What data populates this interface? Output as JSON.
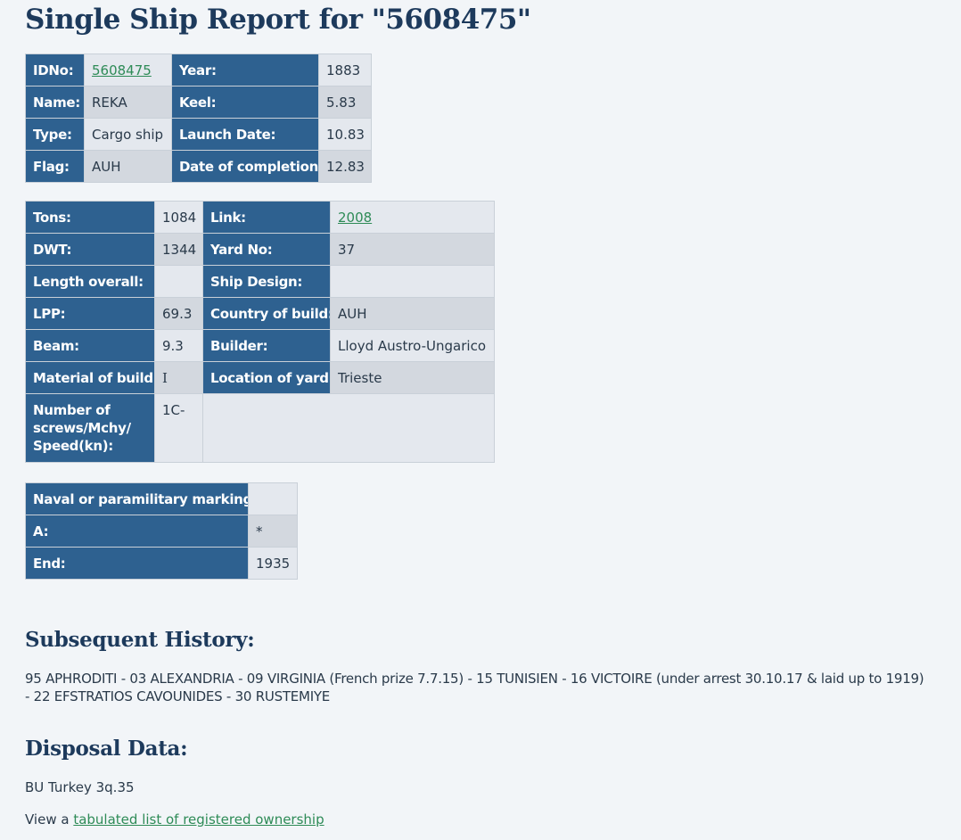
{
  "page_title": "Single Ship Report for \"5608475\"",
  "table1": {
    "rows": [
      {
        "l1": "IDNo:",
        "v1": "5608475",
        "l2": "Year:",
        "v2": "1883"
      },
      {
        "l1": "Name:",
        "v1": "REKA",
        "l2": "Keel:",
        "v2": "5.83"
      },
      {
        "l1": "Type:",
        "v1": "Cargo ship",
        "l2": "Launch Date:",
        "v2": "10.83"
      },
      {
        "l1": "Flag:",
        "v1": "AUH",
        "l2": "Date of completion:",
        "v2": "12.83"
      }
    ]
  },
  "table2": {
    "rows": [
      {
        "l1": "Tons:",
        "v1": "1084",
        "l2": "Link:",
        "v2": "2008"
      },
      {
        "l1": "DWT:",
        "v1": "1344",
        "l2": "Yard No:",
        "v2": "37"
      },
      {
        "l1": "Length overall:",
        "v1": "",
        "l2": "Ship Design:",
        "v2": ""
      },
      {
        "l1": "LPP:",
        "v1": "69.3",
        "l2": "Country of build:",
        "v2": "AUH"
      },
      {
        "l1": "Beam:",
        "v1": "9.3",
        "l2": "Builder:",
        "v2": "Lloyd Austro-Ungarico"
      },
      {
        "l1": "Material of build:",
        "v1": "I",
        "l2": "Location of yard:",
        "v2": "Trieste"
      },
      {
        "l1": "Number of screws/Mchy/ Speed(kn):",
        "v1": "1C-"
      }
    ]
  },
  "table3": {
    "rows": [
      {
        "l": "Naval or paramilitary marking :",
        "v": ""
      },
      {
        "l": "A:",
        "v": "*"
      },
      {
        "l": "End:",
        "v": "1935"
      }
    ]
  },
  "history": {
    "heading": "Subsequent History:",
    "text": "95 APHRODITI - 03 ALEXANDRIA - 09 VIRGINIA (French prize 7.7.15) - 15 TUNISIEN - 16 VICTOIRE (under arrest 30.10.17 & laid up to 1919) - 22 EFSTRATIOS CAVOUNIDES - 30 RUSTEMIYE"
  },
  "disposal": {
    "heading": "Disposal Data:",
    "text": "BU Turkey 3q.35"
  },
  "footer": {
    "prefix": "View a ",
    "link_text": "tabulated list of registered ownership"
  },
  "colors": {
    "label_bg": "#2e6190",
    "value_bg": "#e4e8ee",
    "value_bg_alt": "#d3d8df",
    "heading": "#1d3a5c",
    "link": "#2e8b57",
    "page_bg": "#f2f5f8"
  }
}
